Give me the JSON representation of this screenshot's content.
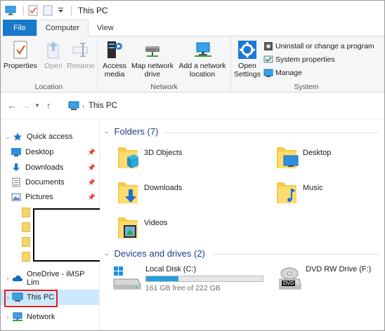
{
  "window": {
    "title": "This PC"
  },
  "ribbon_tabs": [
    "File",
    "Computer",
    "View"
  ],
  "ribbon": {
    "location": {
      "label": "Location",
      "properties": "Properties",
      "open": "Open",
      "rename": "Rename"
    },
    "network": {
      "label": "Network",
      "access_media": "Access media",
      "map_network_drive": "Map network drive",
      "add_network_location": "Add a network location"
    },
    "system": {
      "label": "System",
      "open_settings": "Open Settings",
      "uninstall": "Uninstall or change a program",
      "system_properties": "System properties",
      "manage": "Manage"
    }
  },
  "address": {
    "path": "This PC"
  },
  "nav_pane": {
    "quick_access": "Quick access",
    "items": [
      "Desktop",
      "Downloads",
      "Documents",
      "Pictures"
    ],
    "onedrive": "OneDrive - iMSP Lim",
    "this_pc": "This PC",
    "network": "Network"
  },
  "content": {
    "folders_header": "Folders (7)",
    "folders": [
      "3D Objects",
      "Desktop",
      "Downloads",
      "Music",
      "Videos"
    ],
    "drives_header": "Devices and drives (2)",
    "drives": [
      {
        "name": "Local Disk (C:)",
        "free_text": "161 GB free of 222 GB",
        "used_fraction": 0.275
      },
      {
        "name": "DVD RW Drive (F:)"
      }
    ],
    "dvd_badge": "DVD"
  },
  "colors": {
    "accent": "#1979ca",
    "folder": "#f5d46b",
    "selection": "#cce8ff",
    "highlight_box": "#e02020",
    "drive_fill": "#26a0da"
  }
}
